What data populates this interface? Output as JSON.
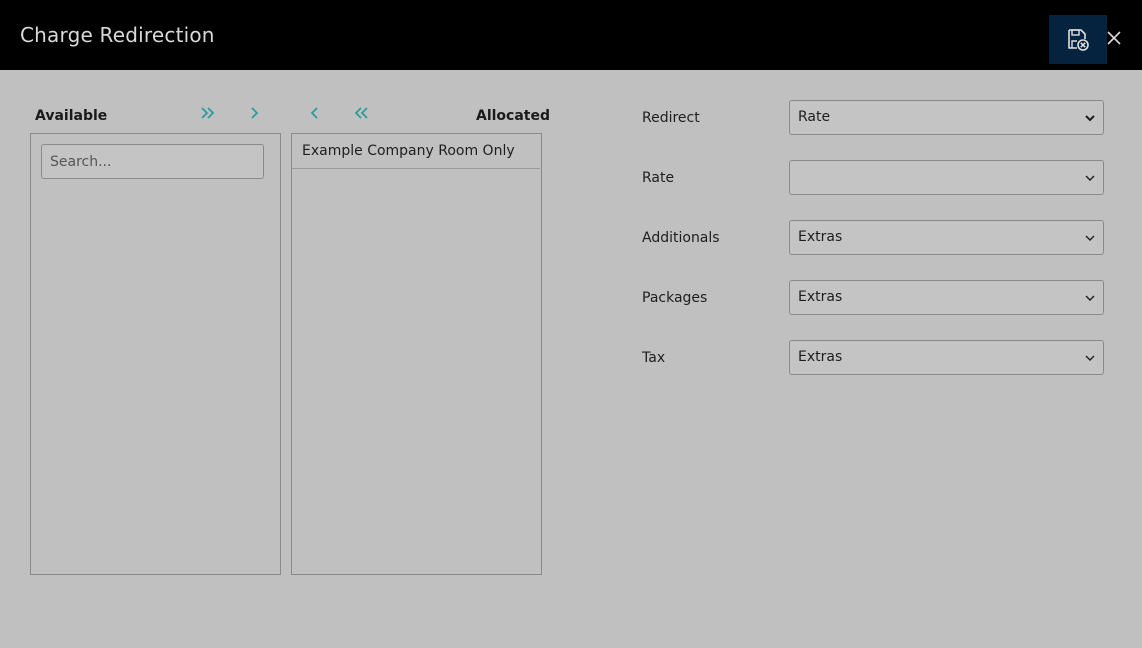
{
  "header": {
    "title": "Charge Redirection",
    "save_icon": "save-cancel-icon",
    "close_icon": "close-icon",
    "save_bg": "#05223e"
  },
  "picker": {
    "available_label": "Available",
    "allocated_label": "Allocated",
    "search_placeholder": "Search...",
    "allocated_items": [
      "Example Company Room Only"
    ],
    "accent": "#2a9d9d"
  },
  "form": {
    "fields": [
      {
        "label": "Redirect",
        "value": "Rate"
      },
      {
        "label": "Rate",
        "value": ""
      },
      {
        "label": "Additionals",
        "value": "Extras"
      },
      {
        "label": "Packages",
        "value": "Extras"
      },
      {
        "label": "Tax",
        "value": "Extras"
      }
    ]
  }
}
